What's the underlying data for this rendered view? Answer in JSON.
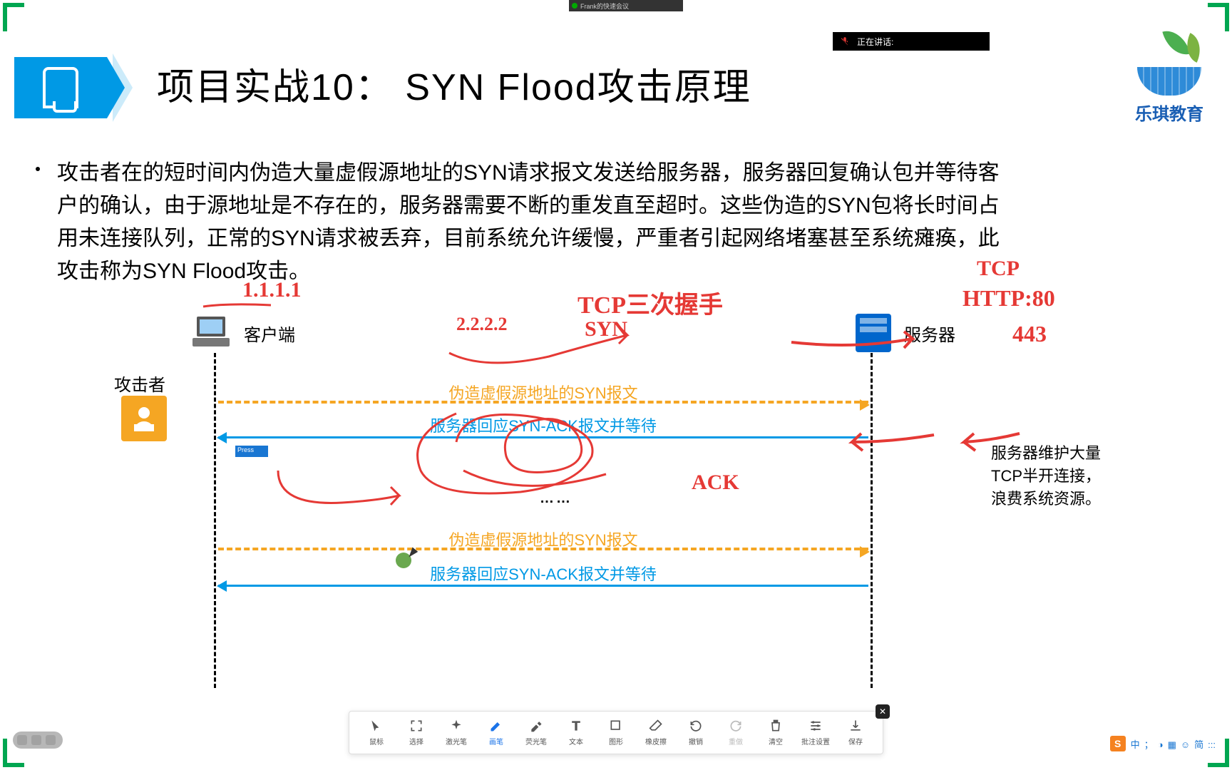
{
  "meeting_tab": "Frank的快速会议",
  "speaking_status": "正在讲话:",
  "title": "项目实战10：  SYN Flood攻击原理",
  "logo_text": "乐琪教育",
  "bullet_text": "攻击者在的短时间内伪造大量虚假源地址的SYN请求报文发送给服务器，服务器回复确认包并等待客户的确认，由于源地址是不存在的，服务器需要不断的重发直至超时。这些伪造的SYN包将长时间占用未连接队列，正常的SYN请求被丢弃，目前系统允许缓慢，严重者引起网络堵塞甚至系统瘫痪，此攻击称为SYN Flood攻击。",
  "diagram": {
    "client": "客户端",
    "server": "服务器",
    "attacker": "攻击者",
    "msg1": "伪造虚假源地址的SYN报文",
    "msg2": "服务器回应SYN-ACK报文并等待",
    "dots": "……",
    "msg3": "伪造虚假源地址的SYN报文",
    "msg4": "服务器回应SYN-ACK报文并等待",
    "side_note": "服务器维护大量TCP半开连接，浪费系统资源。"
  },
  "press_label": "Press",
  "handwriting": {
    "h1": "1.1.1.1",
    "h2": "2.2.2.2",
    "h3": "TCP三次握手",
    "h4": "SYN",
    "h5": "ACK",
    "h6": "TCP",
    "h7": "HTTP:80",
    "h8": "443"
  },
  "toolbar": {
    "items": [
      {
        "name": "鼠标",
        "id": "cursor"
      },
      {
        "name": "选择",
        "id": "select"
      },
      {
        "name": "激光笔",
        "id": "laser"
      },
      {
        "name": "画笔",
        "id": "pen",
        "active": true
      },
      {
        "name": "荧光笔",
        "id": "highlighter"
      },
      {
        "name": "文本",
        "id": "text"
      },
      {
        "name": "图形",
        "id": "shapes"
      },
      {
        "name": "橡皮擦",
        "id": "eraser"
      },
      {
        "name": "撤销",
        "id": "undo"
      },
      {
        "name": "重做",
        "id": "redo",
        "disabled": true
      },
      {
        "name": "清空",
        "id": "clear"
      },
      {
        "name": "批注设置",
        "id": "settings"
      },
      {
        "name": "保存",
        "id": "save"
      }
    ]
  },
  "ime": {
    "brand": "S",
    "pieces": [
      "中",
      "；",
      "◑",
      "▦",
      "☺",
      "简",
      ":::"
    ]
  }
}
